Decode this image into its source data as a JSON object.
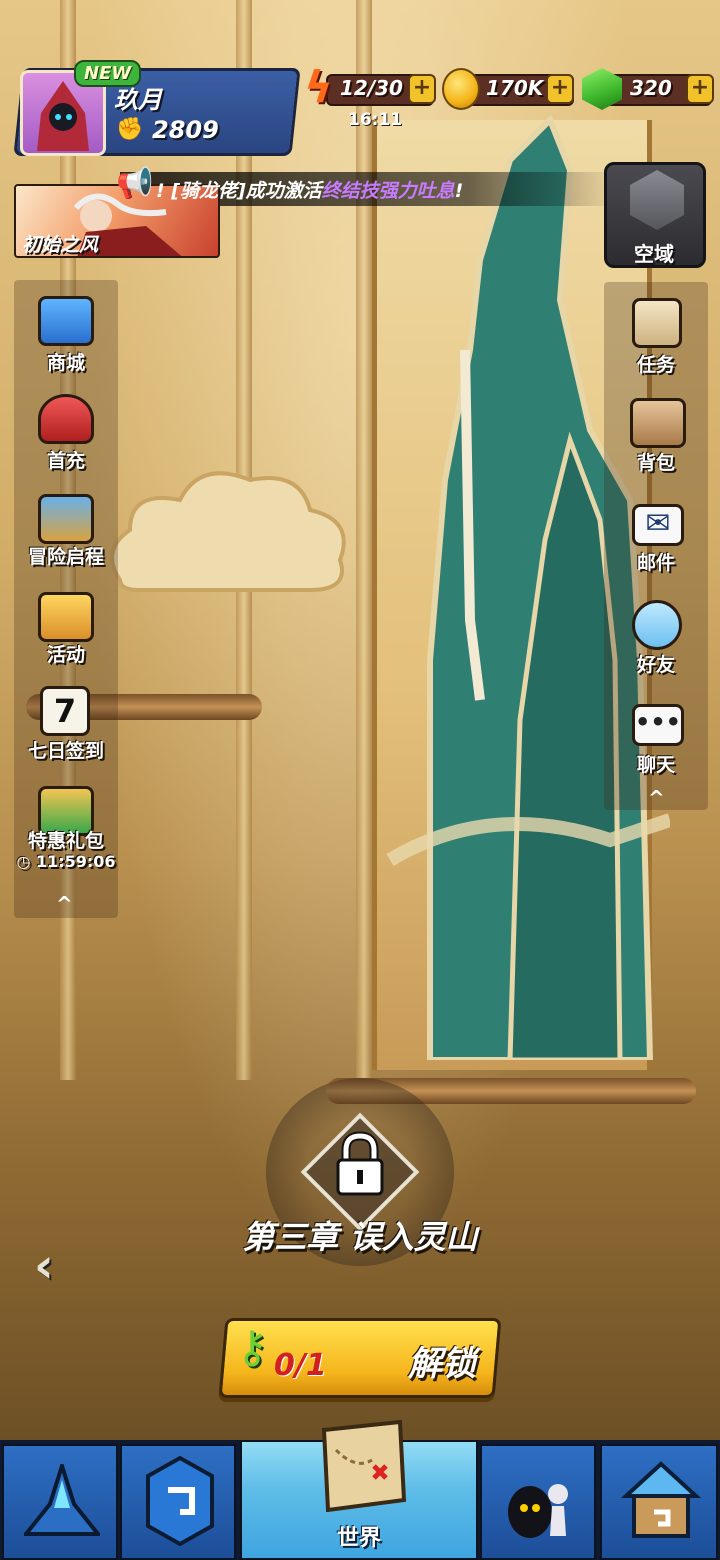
{
  "player": {
    "badge": "NEW",
    "name": "玖月",
    "power": "2809"
  },
  "resources": {
    "energy": "12/30",
    "energy_timer": "16:11",
    "coins": "170K",
    "gems": "320",
    "plus": "+"
  },
  "event_banner": {
    "label": "初始之风"
  },
  "ticker": {
    "prefix": "! [骑龙佬]成功激活",
    "highlight": "终结技强力吐息",
    "suffix": "!"
  },
  "airspace": {
    "label": "空域"
  },
  "left_menu": {
    "items": [
      {
        "label": "商城",
        "icon": "treasure-chest-icon"
      },
      {
        "label": "首充",
        "icon": "dragon-head-icon"
      },
      {
        "label": "冒险启程",
        "icon": "shield-book-icon"
      },
      {
        "label": "活动",
        "icon": "gift-box-icon"
      },
      {
        "label": "七日签到",
        "icon": "calendar-icon",
        "day": "7"
      },
      {
        "label": "特惠礼包",
        "icon": "money-bag-icon",
        "countdown": "11:59:06"
      }
    ],
    "collapse": "^"
  },
  "right_menu": {
    "items": [
      {
        "label": "任务",
        "icon": "scroll-icon"
      },
      {
        "label": "背包",
        "icon": "backpack-icon"
      },
      {
        "label": "邮件",
        "icon": "mail-icon"
      },
      {
        "label": "好友",
        "icon": "friends-icon"
      },
      {
        "label": "聊天",
        "icon": "chat-bubble-icon"
      }
    ],
    "collapse": "^"
  },
  "chapter": {
    "title": "第三章  误入灵山",
    "key_count": "0/1",
    "unlock_label": "解锁",
    "back": "‹"
  },
  "bottom_nav": {
    "tabs": [
      {
        "icon": "crystal-tower-icon",
        "label": ""
      },
      {
        "icon": "rune-card-icon",
        "label": ""
      },
      {
        "icon": "treasure-map-icon",
        "label": "世界",
        "active": true
      },
      {
        "icon": "shadow-hero-icon",
        "label": ""
      },
      {
        "icon": "guild-house-icon",
        "label": ""
      }
    ]
  },
  "colors": {
    "accent_blue": "#2e6fc4",
    "active_tab": "#5fbde8",
    "unlock_button": "#f5b51c",
    "ticker_highlight": "#c77bff",
    "energy": "#ff6a1a"
  }
}
